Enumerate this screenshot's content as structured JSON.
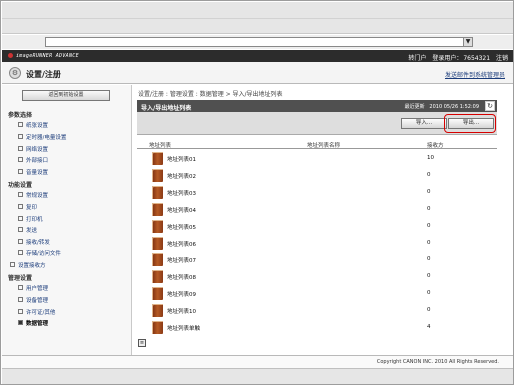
{
  "header": {
    "logo": "imageRUNNER ADVANCE",
    "portal": "转门户",
    "user_prefix": "登录用户：",
    "user_id": "7654321",
    "logout": "注销"
  },
  "titlebar": {
    "icon_glyph": "⚙",
    "title": "设置/注册",
    "send_link": "发送邮件到系统管理员"
  },
  "sidebar": {
    "button": "返回到初始设置",
    "sections": [
      {
        "label": "参数选择",
        "items": [
          {
            "label": "纸张设置"
          },
          {
            "label": "定时器/电量设置"
          },
          {
            "label": "网络设置"
          },
          {
            "label": "外部接口"
          },
          {
            "label": "音量设置"
          }
        ]
      },
      {
        "label": "功能设置",
        "items": [
          {
            "label": "常规设置"
          },
          {
            "label": "复印"
          },
          {
            "label": "打印机"
          },
          {
            "label": "发送"
          },
          {
            "label": "接收/转发"
          },
          {
            "label": "存储/访问文件"
          }
        ]
      },
      {
        "label": "设置接收方",
        "items": []
      },
      {
        "label": "管理设置",
        "items": [
          {
            "label": "用户管理"
          },
          {
            "label": "设备管理"
          },
          {
            "label": "许可证/其他"
          },
          {
            "label": "数据管理",
            "active": true
          }
        ]
      }
    ]
  },
  "breadcrumb": "设置/注册 : 管理设置 : 数据管理 > 导入/导出地址列表",
  "panel": {
    "title": "导入/导出地址列表",
    "updated_label": "最近更新",
    "updated_time": "2010 05/26 1:52:09",
    "refresh_glyph": "↻"
  },
  "toolbar": {
    "import": "导入...",
    "export": "导出..."
  },
  "table": {
    "headers": [
      "地址列表",
      "地址列表名称",
      "接收方"
    ],
    "rows": [
      {
        "name": "地址列表01",
        "count": "10"
      },
      {
        "name": "地址列表02",
        "count": "0"
      },
      {
        "name": "地址列表03",
        "count": "0"
      },
      {
        "name": "地址列表04",
        "count": "0"
      },
      {
        "name": "地址列表05",
        "count": "0"
      },
      {
        "name": "地址列表06",
        "count": "0"
      },
      {
        "name": "地址列表07",
        "count": "0"
      },
      {
        "name": "地址列表08",
        "count": "0"
      },
      {
        "name": "地址列表09",
        "count": "0"
      },
      {
        "name": "地址列表10",
        "count": "0"
      },
      {
        "name": "地址列表单触",
        "count": "4"
      }
    ]
  },
  "pager_glyph": "≡",
  "browser": {
    "dropdown_glyph": "▼"
  },
  "footer": {
    "copyright": "Copyright CANON INC. 2010 All Rights Reserved."
  },
  "colors": {
    "highlight_ring": "#d60000",
    "panel_header": "#505050"
  }
}
